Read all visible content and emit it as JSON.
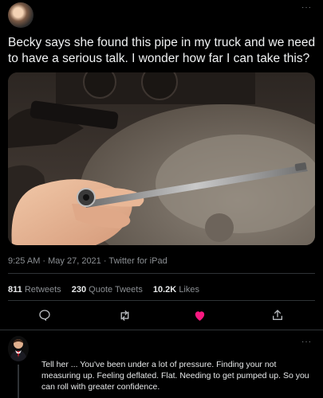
{
  "tweet": {
    "text": "Becky says she found this pipe in my truck and we need to have a serious talk. I wonder how far I can take this?",
    "time": "9:25 AM",
    "date": "May 27, 2021",
    "source": "Twitter for iPad"
  },
  "stats": {
    "retweets_count": "811",
    "retweets_label": "Retweets",
    "quotes_count": "230",
    "quotes_label": "Quote Tweets",
    "likes_count": "10.2K",
    "likes_label": "Likes"
  },
  "more_glyph": "···",
  "reply": {
    "text": "Tell her ... You've been under a lot of pressure. Finding your not measuring up. Feeling deflated. Flat. Needing to get pumped up. So you can roll with greater confidence."
  },
  "icons": {
    "reply": "comment-icon",
    "retweet": "retweet-icon",
    "like": "heart-icon",
    "share": "share-icon"
  },
  "colors": {
    "background": "#000000",
    "text": "#e7e9ea",
    "muted": "#8b8f93",
    "like_active": "#f91880"
  }
}
